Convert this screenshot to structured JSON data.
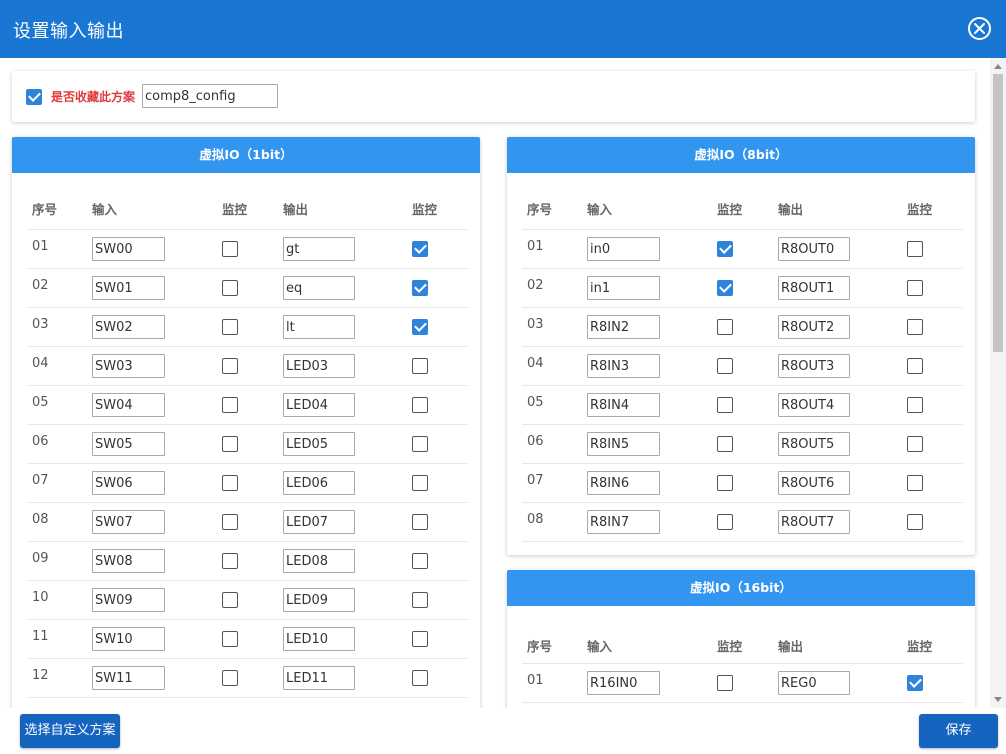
{
  "window": {
    "title": "设置输入输出"
  },
  "favorite": {
    "label": "是否收藏此方案",
    "checked": true,
    "value": "comp8_config"
  },
  "columns": {
    "index": "序号",
    "input": "输入",
    "monitor": "监控",
    "output": "输出"
  },
  "panel_1bit": {
    "title": "虚拟IO（1bit）",
    "rows": [
      {
        "num": "01",
        "input": "SW00",
        "in_mon": false,
        "output": "gt",
        "out_mon": true
      },
      {
        "num": "02",
        "input": "SW01",
        "in_mon": false,
        "output": "eq",
        "out_mon": true
      },
      {
        "num": "03",
        "input": "SW02",
        "in_mon": false,
        "output": "lt",
        "out_mon": true
      },
      {
        "num": "04",
        "input": "SW03",
        "in_mon": false,
        "output": "LED03",
        "out_mon": false
      },
      {
        "num": "05",
        "input": "SW04",
        "in_mon": false,
        "output": "LED04",
        "out_mon": false
      },
      {
        "num": "06",
        "input": "SW05",
        "in_mon": false,
        "output": "LED05",
        "out_mon": false
      },
      {
        "num": "07",
        "input": "SW06",
        "in_mon": false,
        "output": "LED06",
        "out_mon": false
      },
      {
        "num": "08",
        "input": "SW07",
        "in_mon": false,
        "output": "LED07",
        "out_mon": false
      },
      {
        "num": "09",
        "input": "SW08",
        "in_mon": false,
        "output": "LED08",
        "out_mon": false
      },
      {
        "num": "10",
        "input": "SW09",
        "in_mon": false,
        "output": "LED09",
        "out_mon": false
      },
      {
        "num": "11",
        "input": "SW10",
        "in_mon": false,
        "output": "LED10",
        "out_mon": false
      },
      {
        "num": "12",
        "input": "SW11",
        "in_mon": false,
        "output": "LED11",
        "out_mon": false
      }
    ]
  },
  "panel_8bit": {
    "title": "虚拟IO（8bit）",
    "rows": [
      {
        "num": "01",
        "input": "in0",
        "in_mon": true,
        "output": "R8OUT0",
        "out_mon": false
      },
      {
        "num": "02",
        "input": "in1",
        "in_mon": true,
        "output": "R8OUT1",
        "out_mon": false
      },
      {
        "num": "03",
        "input": "R8IN2",
        "in_mon": false,
        "output": "R8OUT2",
        "out_mon": false
      },
      {
        "num": "04",
        "input": "R8IN3",
        "in_mon": false,
        "output": "R8OUT3",
        "out_mon": false
      },
      {
        "num": "05",
        "input": "R8IN4",
        "in_mon": false,
        "output": "R8OUT4",
        "out_mon": false
      },
      {
        "num": "06",
        "input": "R8IN5",
        "in_mon": false,
        "output": "R8OUT5",
        "out_mon": false
      },
      {
        "num": "07",
        "input": "R8IN6",
        "in_mon": false,
        "output": "R8OUT6",
        "out_mon": false
      },
      {
        "num": "08",
        "input": "R8IN7",
        "in_mon": false,
        "output": "R8OUT7",
        "out_mon": false
      }
    ]
  },
  "panel_16bit": {
    "title": "虚拟IO（16bit）",
    "rows": [
      {
        "num": "01",
        "input": "R16IN0",
        "in_mon": false,
        "output": "REG0",
        "out_mon": true
      }
    ]
  },
  "buttons": {
    "choose": "选择自定义方案",
    "save": "保存"
  },
  "colors": {
    "titlebar": "#1976d2",
    "panel_header": "#3296f0",
    "checkbox": "#2f83d9",
    "button": "#1565c0",
    "favorite_label": "#e03b3b"
  },
  "icons": {
    "close": "close-circle-icon"
  }
}
